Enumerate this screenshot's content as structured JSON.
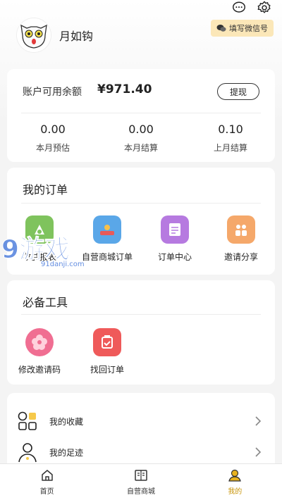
{
  "header": {
    "username": "月如钩",
    "wechat_button": "填写微信号",
    "icons": [
      "message-icon",
      "settings-icon"
    ]
  },
  "balance": {
    "label": "账户可用余额",
    "amount": "¥971.40",
    "withdraw": "提现",
    "stats": [
      {
        "value": "0.00",
        "label": "本月预估"
      },
      {
        "value": "0.00",
        "label": "本月结算"
      },
      {
        "value": "0.10",
        "label": "上月结算"
      }
    ]
  },
  "orders": {
    "title": "我的订单",
    "items": [
      {
        "label": "收益报表",
        "icon": "report-icon",
        "color": "#7fc35d"
      },
      {
        "label": "自营商城订单",
        "icon": "shop-icon",
        "color": "#5aa7e8"
      },
      {
        "label": "订单中心",
        "icon": "order-icon",
        "color": "#b67ae0"
      },
      {
        "label": "邀请分享",
        "icon": "invite-icon",
        "color": "#f5a86a"
      }
    ]
  },
  "tools": {
    "title": "必备工具",
    "items": [
      {
        "label": "修改邀请码",
        "icon": "flower-icon",
        "color": "#f06e92"
      },
      {
        "label": "找回订单",
        "icon": "retrieve-icon",
        "color": "#ef5a5a"
      }
    ]
  },
  "list": [
    {
      "label": "我的收藏",
      "icon": "favorites-icon"
    },
    {
      "label": "我的足迹",
      "icon": "footprint-icon"
    }
  ],
  "tabbar": [
    {
      "label": "首页",
      "icon": "home-icon"
    },
    {
      "label": "自营商城",
      "icon": "book-icon"
    },
    {
      "label": "我的",
      "icon": "profile-icon",
      "active": true
    }
  ],
  "watermark": {
    "main": "9游戏",
    "sub": "91danji.com"
  },
  "colors": {
    "accent": "#c9960c",
    "wechat_bg": "#fbe7b8"
  }
}
